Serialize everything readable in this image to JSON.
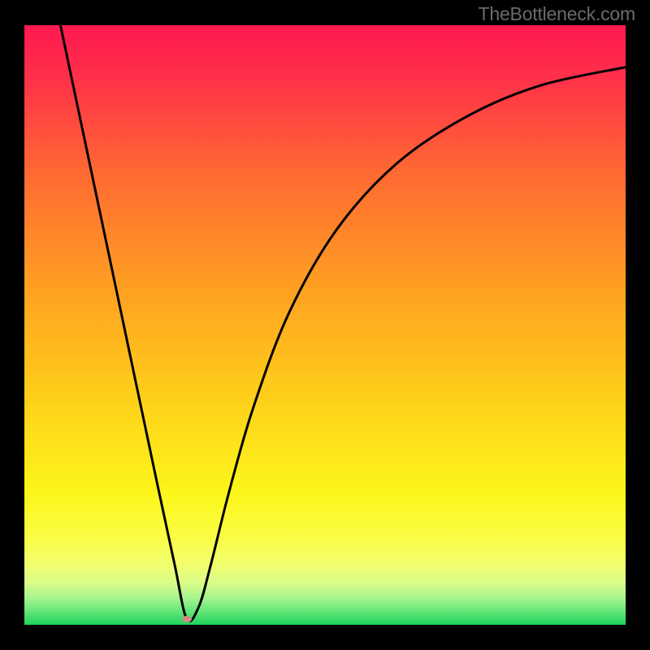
{
  "attribution": "TheBottleneck.com",
  "chart_data": {
    "type": "line",
    "title": "",
    "xlabel": "",
    "ylabel": "",
    "xlim": [
      0,
      100
    ],
    "ylim": [
      0,
      100
    ],
    "grid": false,
    "legend": false,
    "series": [
      {
        "name": "bottleneck-curve",
        "x": [
          6,
          10,
          14,
          18,
          22,
          25,
          27,
          29,
          31,
          34,
          38,
          44,
          52,
          62,
          74,
          86,
          100
        ],
        "y": [
          100,
          81,
          62,
          43,
          24,
          10,
          1,
          3,
          10,
          22,
          36,
          52,
          66,
          77,
          85,
          90,
          93
        ]
      }
    ],
    "annotations": [
      {
        "name": "minimum-marker",
        "x": 27,
        "y": 1,
        "shape": "ellipse",
        "color": "#cc8d86"
      }
    ],
    "background_gradient": {
      "type": "vertical",
      "stops": [
        {
          "pos": 0.0,
          "color": "#ff1950"
        },
        {
          "pos": 0.08,
          "color": "#ff2e4a"
        },
        {
          "pos": 0.25,
          "color": "#ff6a32"
        },
        {
          "pos": 0.45,
          "color": "#ffa321"
        },
        {
          "pos": 0.63,
          "color": "#ffd21a"
        },
        {
          "pos": 0.78,
          "color": "#fcf61a"
        },
        {
          "pos": 0.85,
          "color": "#fafd43"
        },
        {
          "pos": 0.9,
          "color": "#f2fe6f"
        },
        {
          "pos": 0.93,
          "color": "#d9fc87"
        },
        {
          "pos": 0.955,
          "color": "#a6f58d"
        },
        {
          "pos": 0.975,
          "color": "#6ce87b"
        },
        {
          "pos": 1.0,
          "color": "#1fd35e"
        }
      ]
    }
  }
}
